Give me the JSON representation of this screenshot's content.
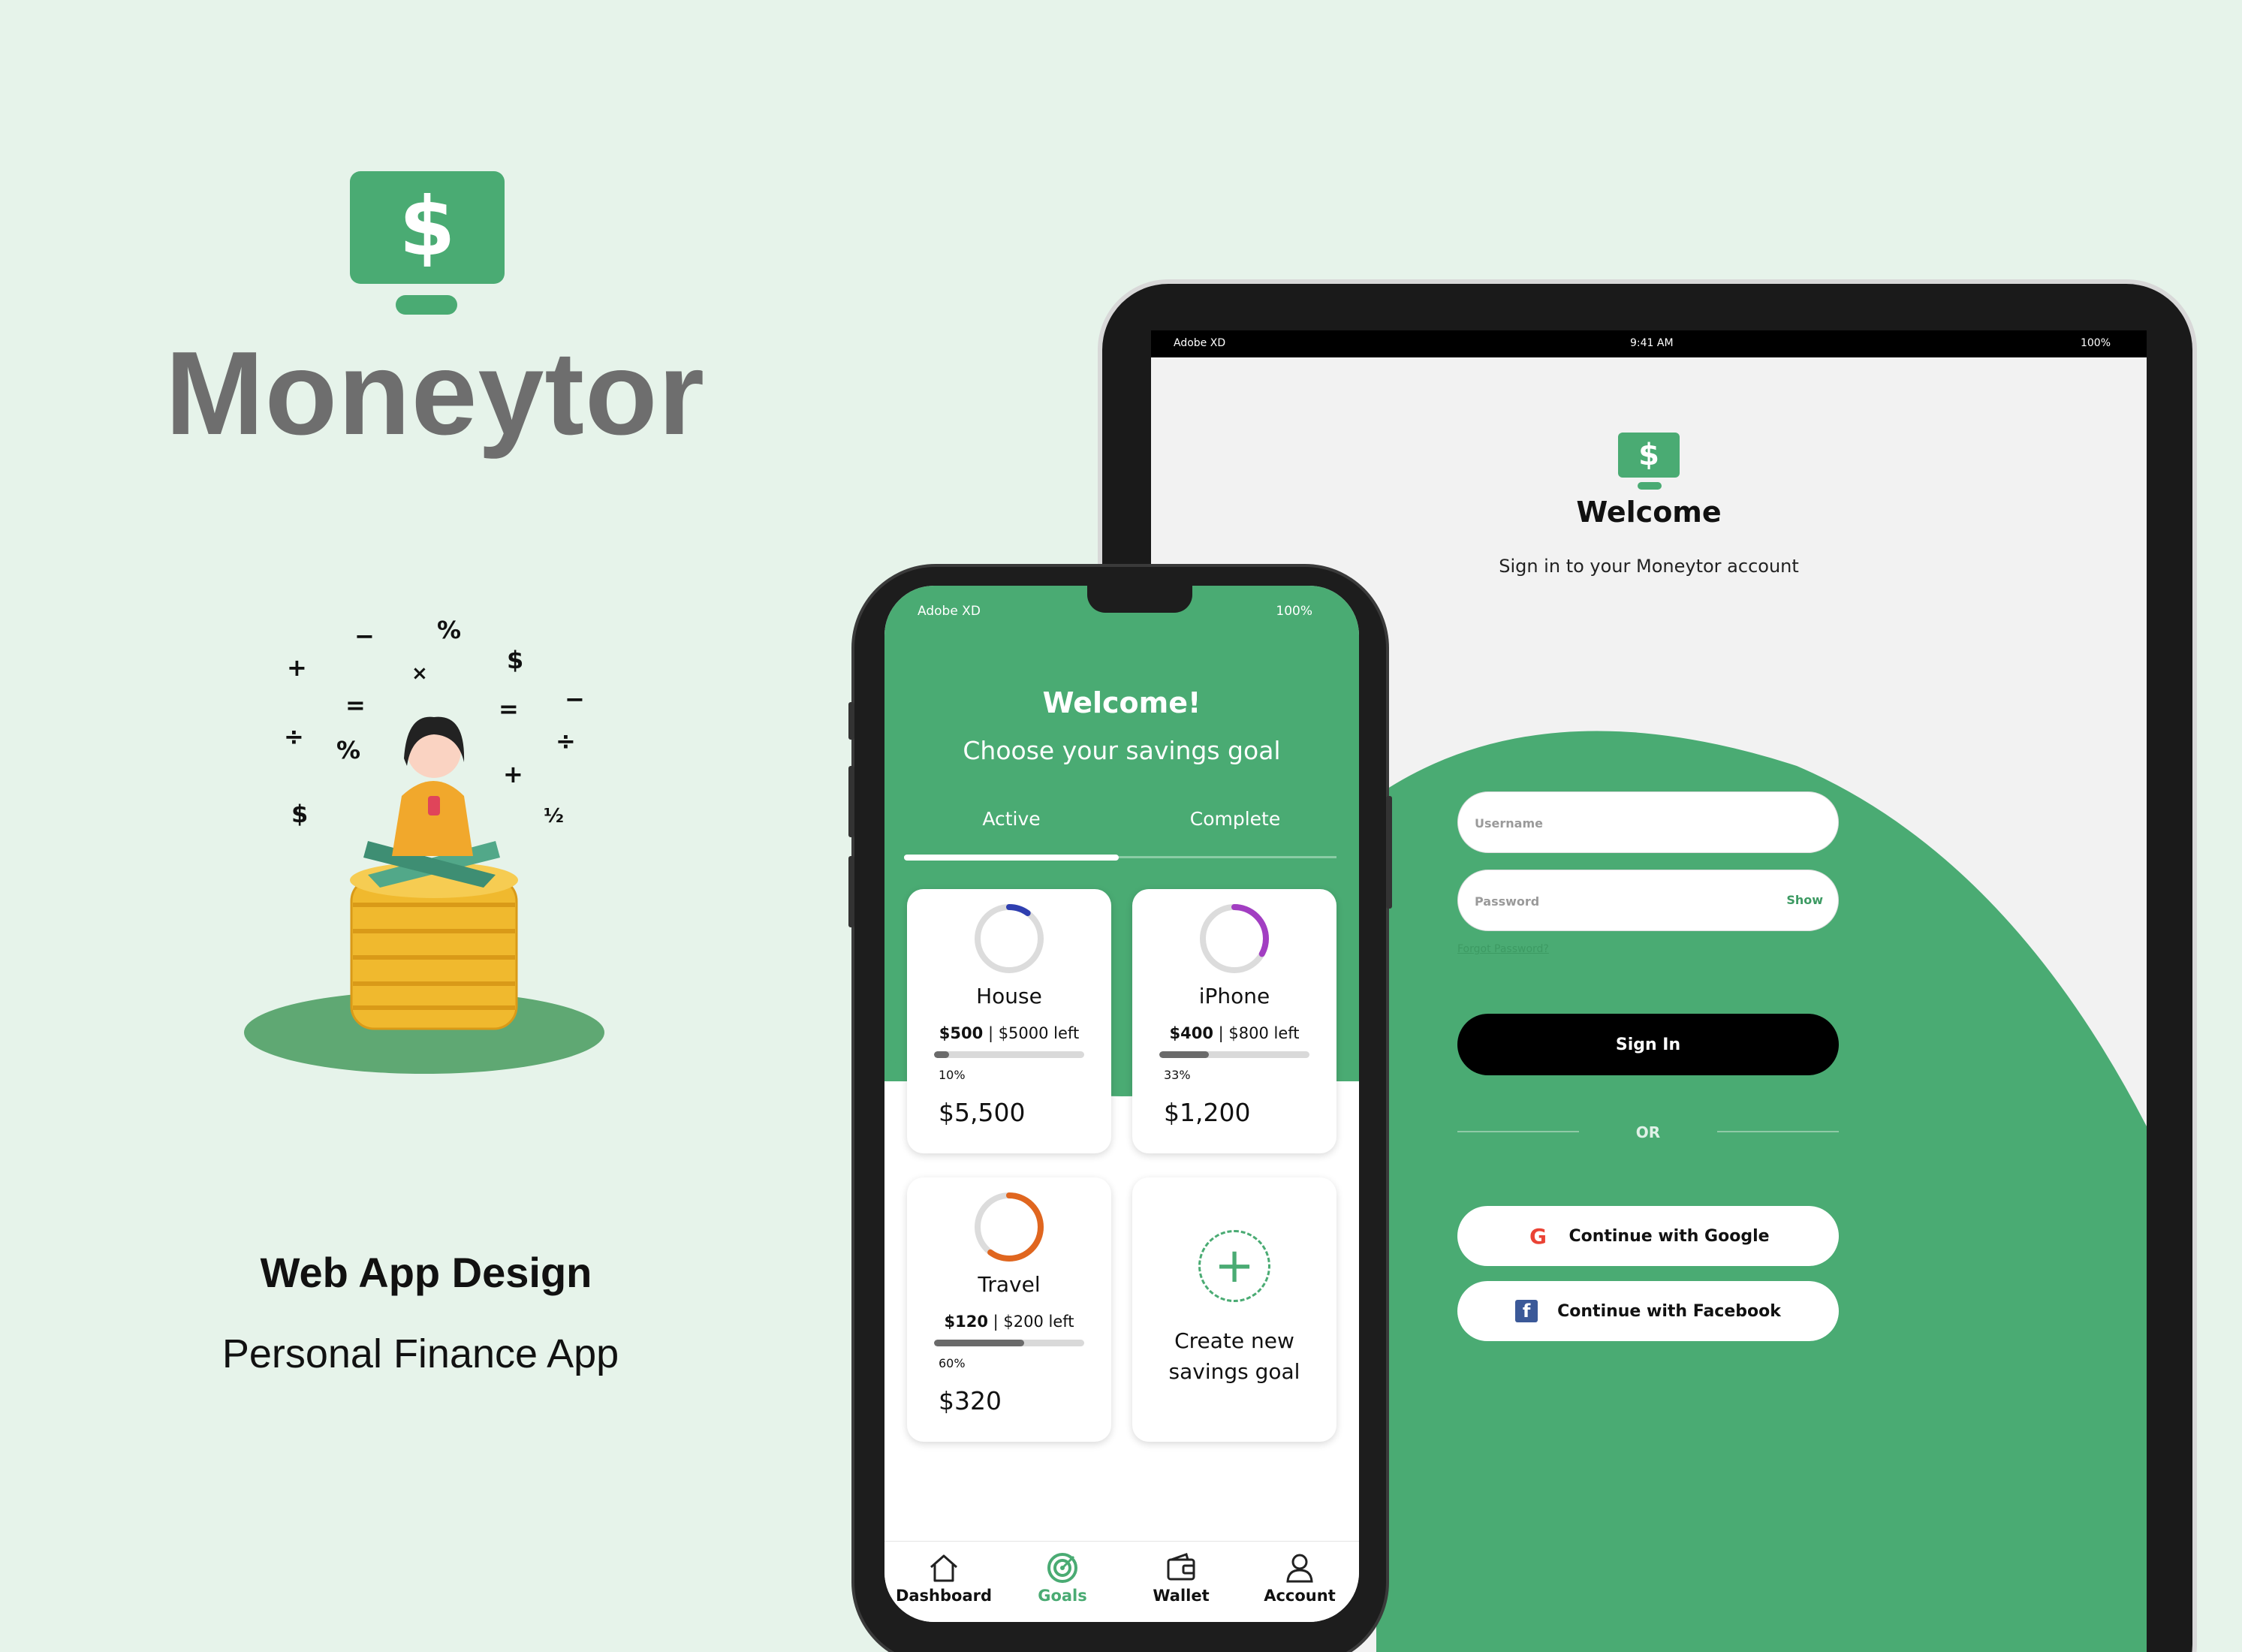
{
  "brand": {
    "name": "Moneytor",
    "logo_symbol": "$",
    "tagline_1": "Web App Design",
    "tagline_2": "Personal Finance App",
    "accent_color": "#4aab73"
  },
  "illustration": {
    "symbols": [
      "+",
      "−",
      "%",
      "$",
      "×",
      "=",
      "=",
      "−",
      "÷",
      "%",
      "+",
      "÷",
      "$",
      "½"
    ]
  },
  "tablet": {
    "status": {
      "carrier": "Adobe XD",
      "time": "9:41 AM",
      "battery": "100%"
    },
    "logo_symbol": "$",
    "title": "Welcome",
    "subtitle": "Sign in to your Moneytor account",
    "username_placeholder": "Username",
    "password_placeholder": "Password",
    "show_label": "Show",
    "forgot_label": "Forgot Password?",
    "signin_label": "Sign In",
    "or_label": "OR",
    "google_label": "Continue with Google",
    "facebook_label": "Continue with Facebook"
  },
  "phone": {
    "status": {
      "carrier": "Adobe XD",
      "battery": "100%"
    },
    "title": "Welcome!",
    "subtitle": "Choose your savings goal",
    "tabs": [
      "Active",
      "Complete"
    ],
    "goals": [
      {
        "name": "House",
        "saved": "$500",
        "left": "| $5000 left",
        "percent": "10%",
        "progress": 0.1,
        "total": "$5,500",
        "color": "#2f3fb0"
      },
      {
        "name": "iPhone",
        "saved": "$400",
        "left": "| $800 left",
        "percent": "33%",
        "progress": 0.33,
        "total": "$1,200",
        "color": "#a23ec2"
      },
      {
        "name": "Travel",
        "saved": "$120",
        "left": "| $200 left",
        "percent": "60%",
        "progress": 0.6,
        "total": "$320",
        "color": "#e0661f"
      }
    ],
    "new_goal_line1": "Create new",
    "new_goal_line2": "savings goal",
    "nav": [
      "Dashboard",
      "Goals",
      "Wallet",
      "Account"
    ]
  }
}
